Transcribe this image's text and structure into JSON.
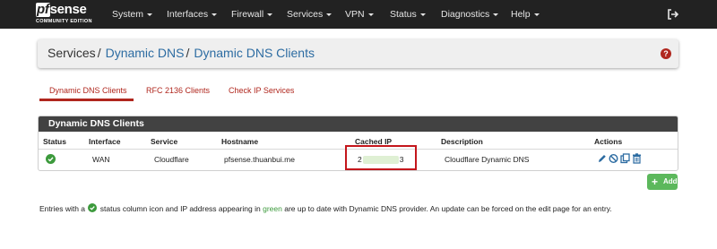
{
  "brand": {
    "name": "sense",
    "mark": "pf",
    "edition": "COMMUNITY EDITION"
  },
  "nav": [
    "System",
    "Interfaces",
    "Firewall",
    "Services",
    "VPN",
    "Status",
    "Diagnostics",
    "Help"
  ],
  "breadcrumb": {
    "root": "Services",
    "sep": "/",
    "section": "Dynamic DNS",
    "page": "Dynamic DNS Clients"
  },
  "tabs": [
    "Dynamic DNS Clients",
    "RFC 2136 Clients",
    "Check IP Services"
  ],
  "active_tab": "Dynamic DNS Clients",
  "panel_title": "Dynamic DNS Clients",
  "columns": [
    "Status",
    "Interface",
    "Service",
    "Hostname",
    "Cached IP",
    "Description",
    "Actions"
  ],
  "rows": [
    {
      "status": "up-to-date",
      "interface": "WAN",
      "service": "Cloudflare",
      "hostname": "pfsense.thuanbui.me",
      "ip_start": "2",
      "ip_end": "3",
      "description": "Cloudflare Dynamic DNS"
    }
  ],
  "add_label": "Add",
  "footnote": {
    "before": "Entries with a",
    "mid": "status column icon and IP address appearing in",
    "green": "green",
    "after": "are up to date with Dynamic DNS provider. An update can be forced on the edit page for an entry."
  },
  "colors": {
    "navbar": "#222222",
    "accent": "#b0271e",
    "link": "#2d6ca2",
    "success": "#5cb85c",
    "highlight_box": "#c4161c"
  }
}
